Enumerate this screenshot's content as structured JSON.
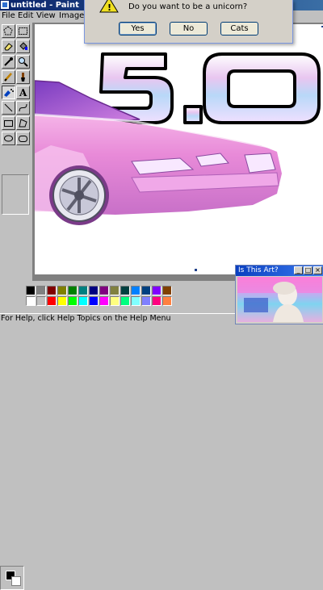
{
  "window": {
    "title": "untitled - Paint"
  },
  "menu": {
    "items": [
      "File",
      "Edit",
      "View",
      "Image"
    ]
  },
  "dialog": {
    "message": "Do you want to be a unicorn?",
    "buttons": [
      "Yes",
      "No",
      "Cats"
    ]
  },
  "statusbar": {
    "text": "For Help, click Help Topics on the Help Menu"
  },
  "mini_window": {
    "title": "Is This Art?"
  },
  "palette": {
    "row1": [
      "#000000",
      "#808080",
      "#800000",
      "#808000",
      "#008000",
      "#008080",
      "#000080",
      "#800080",
      "#808040",
      "#004040",
      "#0080ff",
      "#004080",
      "#8000ff",
      "#804000"
    ],
    "row2": [
      "#ffffff",
      "#c0c0c0",
      "#ff0000",
      "#ffff00",
      "#00ff00",
      "#00ffff",
      "#0000ff",
      "#ff00ff",
      "#ffff80",
      "#00ff80",
      "#80ffff",
      "#8080ff",
      "#ff0080",
      "#ff8040"
    ]
  },
  "canvas": {
    "lettering": "5.0"
  },
  "colors": {
    "car_pink": "#e88ad8",
    "title_blue": "#0a246a"
  }
}
